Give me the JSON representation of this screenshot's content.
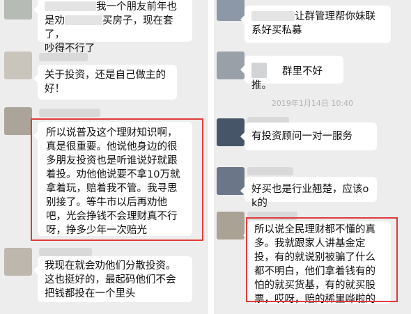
{
  "left_chat": {
    "messages": [
      {
        "text_a": "我一个朋友前年也",
        "text_b": "是劝",
        "text_c": "买房子，现在套了，",
        "text_d": "吵得不行了"
      },
      {
        "text": "关于投资，还是自己做主的好！"
      },
      {
        "text": "所以说普及这个理财知识啊，真是很重要。他说他身边的很多朋友投资也是听谁说好就跟着投。劝他他说要不拿10万就拿着玩，赔着我不管。我寻思别接了。等牛市以后再劝他吧，光会挣钱不会理财真不行呀，挣多少年一次赔光"
      },
      {
        "text": "我现在就会劝他们分散投资。这也挺好的，最起码他们不会把钱都投在一个里头"
      }
    ]
  },
  "right_chat": {
    "messages": [
      {
        "text": "让群管理帮你妹联系好买私募"
      },
      {
        "text": "群里不好推。"
      },
      {
        "text": "有投资顾问一对一服务"
      },
      {
        "text": "好买也是行业翘楚，应该ok的"
      },
      {
        "text": "所以说全民理财都不懂的真多。我就跟家人讲基金定投，有的就说别被骗了什么都不明白，他们拿着钱有的怕的就买货基，有的就买股票，哎呀，赔的稀里哗啦的"
      }
    ],
    "timestamp": "2019年1月14日 10:40"
  },
  "colors": {
    "chat_background": "#ededed",
    "bubble": "#ffffff",
    "highlight_box": "#e03a3a",
    "timestamp_text": "#b2b2b2"
  }
}
